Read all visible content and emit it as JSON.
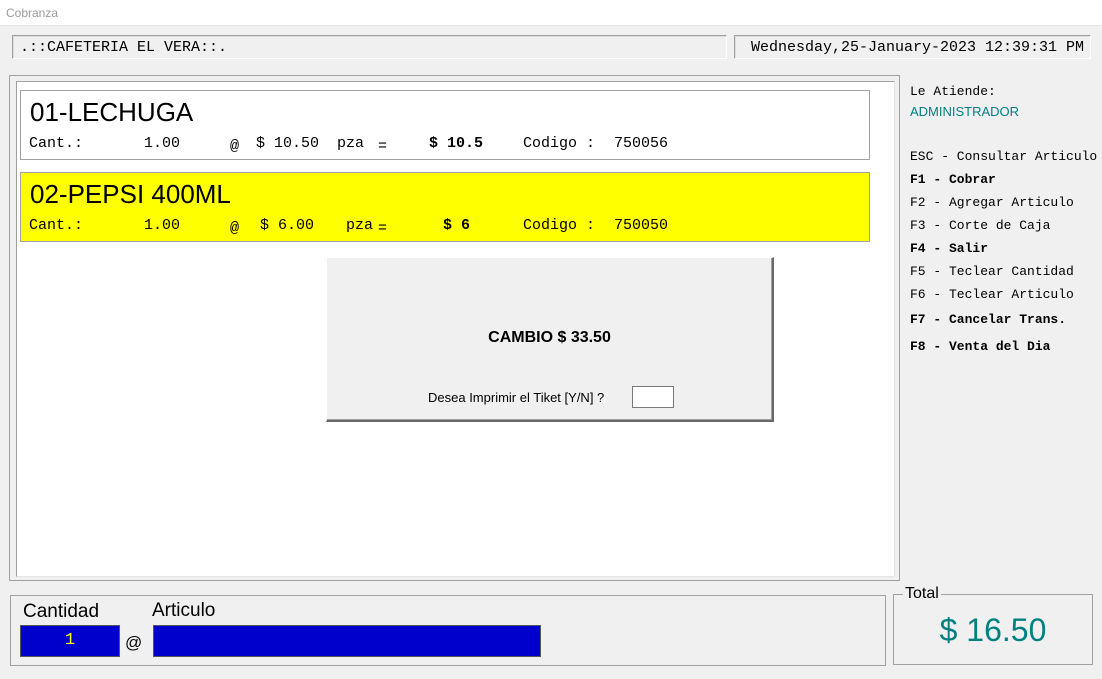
{
  "window": {
    "title": "Cobranza"
  },
  "header": {
    "store_name": ".::CAFETERIA EL VERA::.",
    "datetime": "Wednesday,25-January-2023 12:39:31 PM"
  },
  "items": [
    {
      "name": "01-LECHUGA",
      "qty_label": "Cant.:",
      "qty": "1.00",
      "at": "@",
      "price": "$ 10.50",
      "unit": "pza",
      "eq": "=",
      "total": "$ 10.5",
      "code_label": "Codigo :",
      "code": "750056",
      "highlight": "#ffffff"
    },
    {
      "name": "02-PEPSI 400ML",
      "qty_label": "Cant.:",
      "qty": "1.00",
      "at": "@",
      "price": "$ 6.00",
      "unit": "pza",
      "eq": "=",
      "total": "$ 6",
      "code_label": "Codigo :",
      "code": "750050",
      "highlight": "#ffff00"
    }
  ],
  "dialog": {
    "cambio": "CAMBIO $ 33.50",
    "prompt": "Desea Imprimir el Tiket  [Y/N]  ?",
    "input_value": ""
  },
  "sidebar": {
    "attendant_label": "Le Atiende:",
    "attendant": "ADMINISTRADOR",
    "attendant_color": "#008080",
    "shortcuts": [
      "ESC - Consultar Articulo",
      "F1 -  Cobrar",
      "F2 - Agregar Articulo",
      "F3 - Corte de Caja",
      "F4 - Salir",
      "F5 - Teclear Cantidad",
      "F6 - Teclear Articulo",
      "F7 - Cancelar Trans.",
      "F8 - Venta del Dia"
    ]
  },
  "bottom": {
    "cantidad_label": "Cantidad",
    "cantidad_value": "1",
    "at": "@",
    "articulo_label": "Articulo",
    "articulo_value": "",
    "field_color": "#0000cc"
  },
  "total": {
    "label": "Total",
    "value": "$ 16.50",
    "color": "#008080"
  }
}
